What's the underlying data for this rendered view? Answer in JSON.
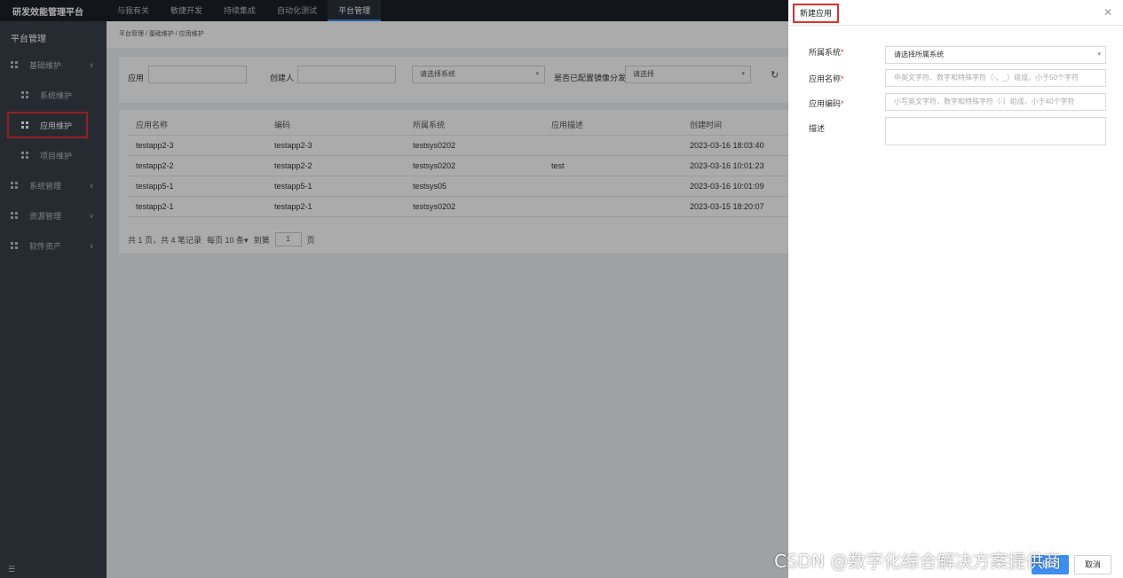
{
  "app": {
    "brand": "研发效能管理平台"
  },
  "topnav": [
    {
      "label": "与我有关",
      "active": false
    },
    {
      "label": "敏捷开发",
      "active": false
    },
    {
      "label": "持续集成",
      "active": false
    },
    {
      "label": "自动化测试",
      "active": false
    },
    {
      "label": "平台管理",
      "active": true
    }
  ],
  "sidebar": {
    "title": "平台管理",
    "items": [
      {
        "label": "基础维护",
        "icon": "grid-icon",
        "expanded": true
      },
      {
        "label": "系统维护",
        "icon": "grid-icon"
      },
      {
        "label": "应用维护",
        "icon": "grid-icon",
        "active": true
      },
      {
        "label": "项目维护",
        "icon": "grid-icon"
      },
      {
        "label": "系统管理",
        "icon": "grid-icon"
      },
      {
        "label": "资源管理",
        "icon": "grid-icon"
      },
      {
        "label": "软件资产",
        "icon": "grid-icon"
      }
    ],
    "footer_icon": "menu-collapse-icon"
  },
  "breadcrumb": "平台管理 / 基础维护 / 应用维护",
  "filters": {
    "app_label": "应用",
    "creator_label": "创建人",
    "system_select": "请选择系统",
    "mirror_label": "是否已配置镜像分发",
    "mirror_select": "请选择"
  },
  "table": {
    "headers": [
      "应用名称",
      "编码",
      "所属系统",
      "应用描述",
      "创建时间"
    ],
    "rows": [
      [
        "testapp2-3",
        "testapp2-3",
        "testsys0202",
        "",
        "2023-03-16 18:03:40"
      ],
      [
        "testapp2-2",
        "testapp2-2",
        "testsys0202",
        "test",
        "2023-03-16 10:01:23"
      ],
      [
        "testapp5-1",
        "testapp5-1",
        "testsys05",
        "",
        "2023-03-16 10:01:09"
      ],
      [
        "testapp2-1",
        "testapp2-1",
        "testsys0202",
        "",
        "2023-03-15 18:20:07"
      ]
    ]
  },
  "pager": {
    "summary": "共 1 页，共 4 笔记录",
    "page_size": "每页 10 条",
    "goto": "到第",
    "page": "1",
    "unit": "页"
  },
  "drawer": {
    "title": "新建应用",
    "fields": {
      "system_label": "所属系统",
      "system_placeholder": "请选择所属系统",
      "name_label": "应用名称",
      "name_placeholder": "中英文字符、数字和特殊字符（-、_）组成，小于50个字符",
      "code_label": "应用编码",
      "code_placeholder": "小写英文字符、数字和特殊字符（-）组成，小于40个字符",
      "desc_label": "描述"
    },
    "ok_label": "确定",
    "cancel_label": "取消"
  },
  "watermark": "CSDN @数字化综合解决方案提供商",
  "colors": {
    "accent": "#3d8ef0",
    "highlight": "#e03030",
    "sidebar": "#3a4149",
    "topbar": "#1c2229"
  }
}
